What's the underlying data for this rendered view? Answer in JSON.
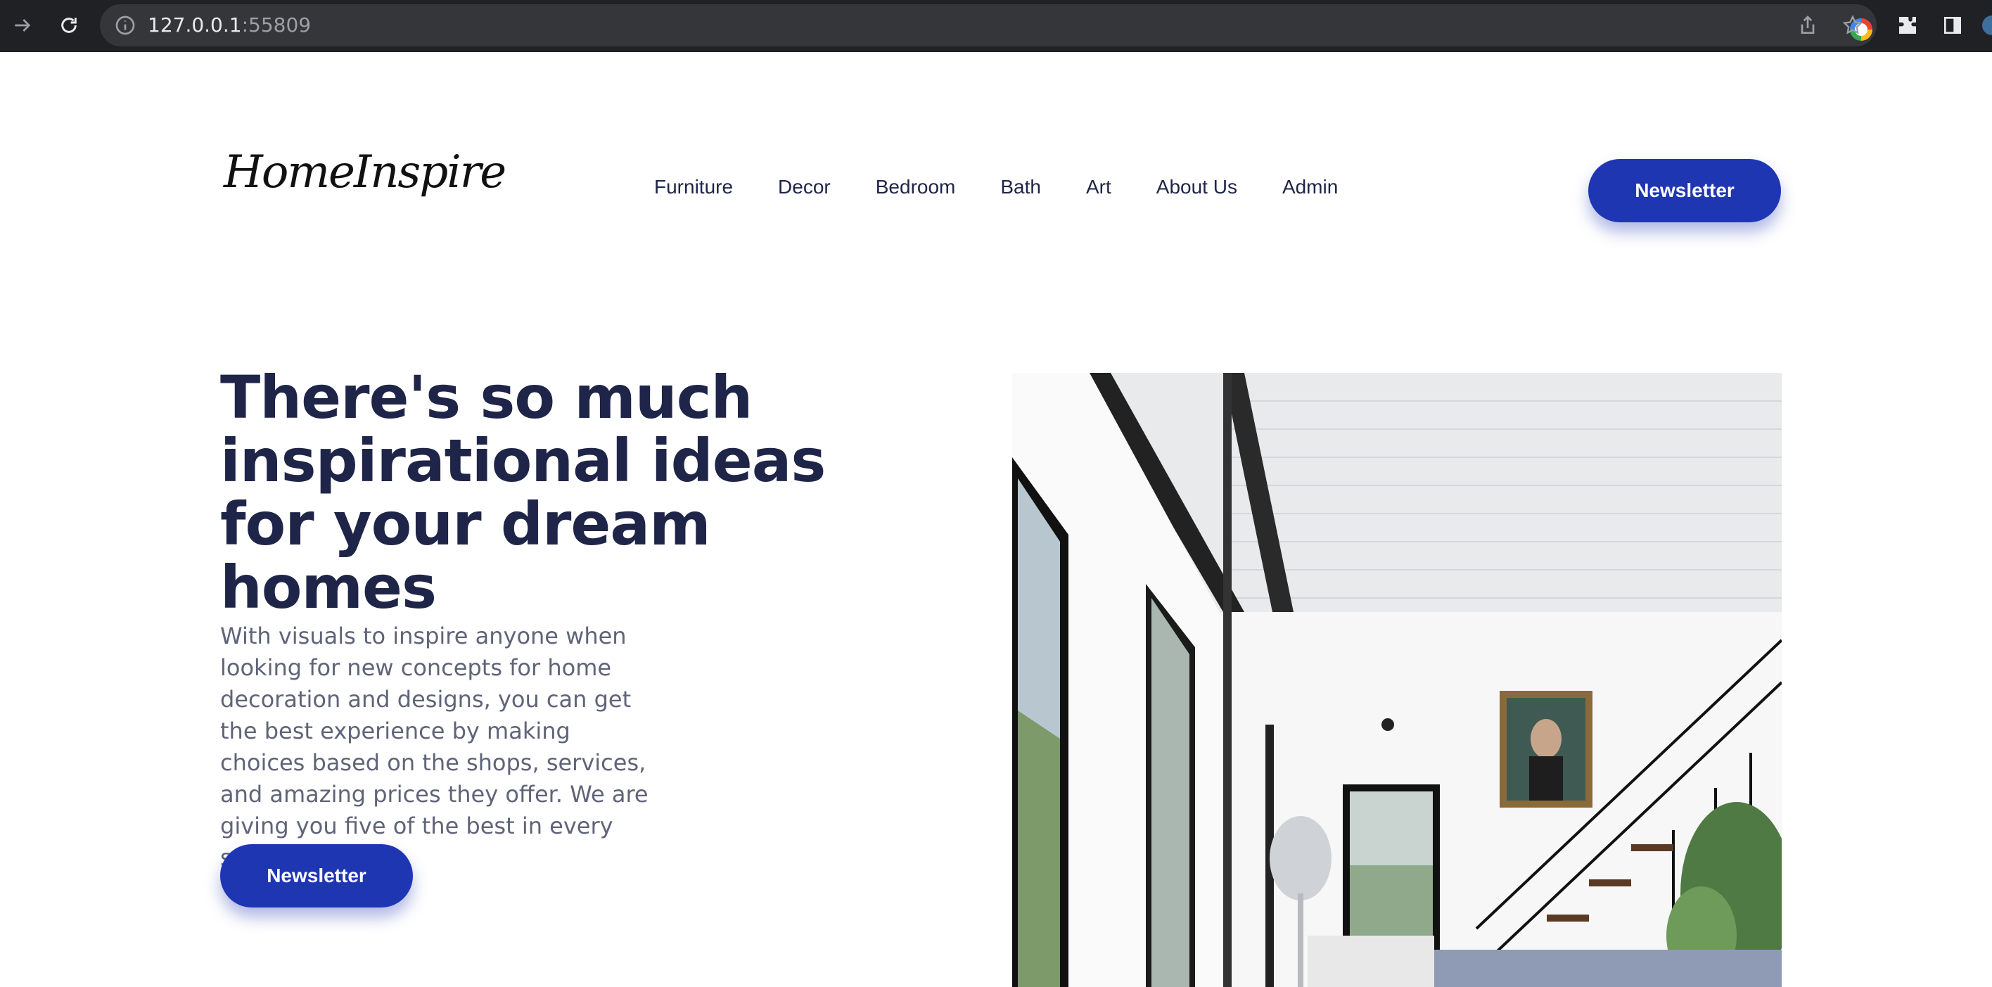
{
  "browser": {
    "url_host": "127.0.0.1",
    "url_port": ":55809",
    "icons": [
      "forward-icon",
      "reload-icon",
      "info-icon",
      "google-icon",
      "share-icon",
      "star-icon",
      "extensions-icon",
      "sidebar-icon"
    ]
  },
  "header": {
    "logo": "HomeInspire",
    "nav": [
      "Furniture",
      "Decor",
      "Bedroom",
      "Bath",
      "Art",
      "About Us",
      "Admin"
    ],
    "cta_label": "Newsletter"
  },
  "hero": {
    "title": "There's so much inspirational ideas for your dream homes",
    "body": "With visuals to inspire anyone when looking for new concepts for home decoration and designs, you can get the best experience by making choices based on the shops, services, and amazing prices they offer. We are giving you five of the best in every section.",
    "cta_label": "Newsletter"
  },
  "colors": {
    "accent": "#1f36b3",
    "heading": "#1e2548",
    "body_text": "#5f6478",
    "chrome": "#202124"
  }
}
